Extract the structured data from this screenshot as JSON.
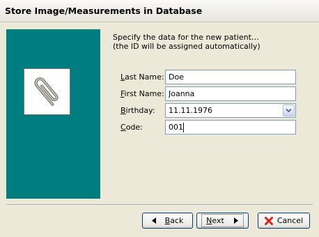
{
  "window": {
    "title": "Store Image/Measurements in Database"
  },
  "intro": {
    "line1": "Specify the data for the new patient…",
    "line2": "(the ID will be assigned automatically)"
  },
  "fields": {
    "last_name": {
      "label_key": "L",
      "label_rest": "ast Name:",
      "value": "Doe"
    },
    "first_name": {
      "label_key": "F",
      "label_rest": "irst Name:",
      "value": "Joanna"
    },
    "birthday": {
      "label_key": "B",
      "label_rest": "irthday:",
      "value": "11.11.1976"
    },
    "code": {
      "label_key": "C",
      "label_rest": "ode:",
      "value": "001"
    }
  },
  "buttons": {
    "back": {
      "key": "B",
      "rest": "ack"
    },
    "next": {
      "key": "N",
      "rest": "ext"
    },
    "cancel": {
      "label": "Cancel"
    }
  },
  "icons": {
    "side_image": "paperclip-icon",
    "back": "left-triangle-icon",
    "next": "right-triangle-icon",
    "cancel": "red-x-icon",
    "dropdown": "chevron-down-icon"
  },
  "colors": {
    "side_panel": "#007d7f",
    "cancel_x": "#d2261b"
  }
}
